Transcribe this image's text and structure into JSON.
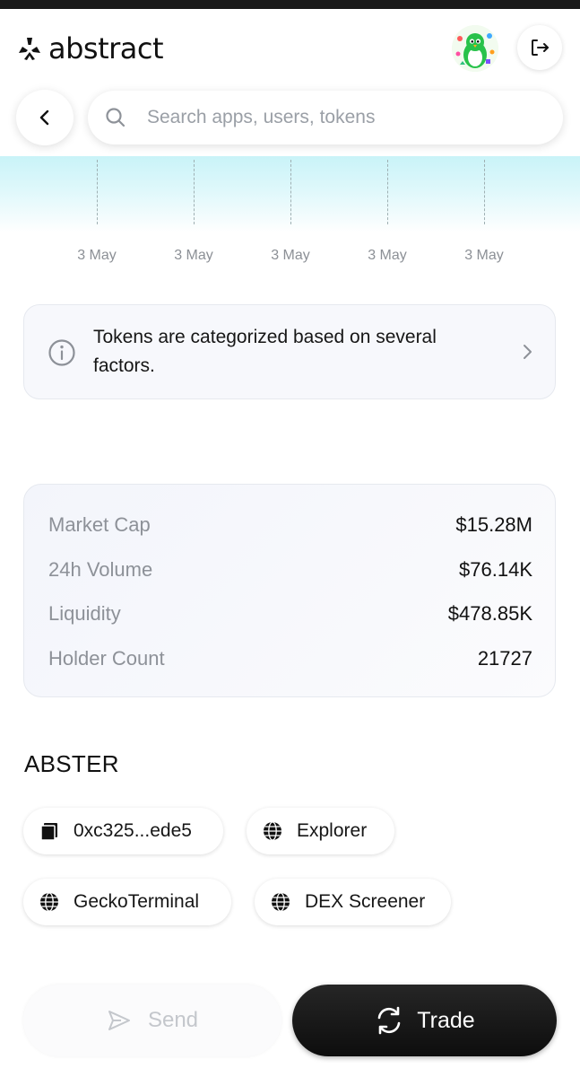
{
  "header": {
    "brand": "abstract",
    "icons": {
      "logo": "abstract-logo-icon",
      "avatar": "penguin-avatar",
      "logout": "logout-icon"
    }
  },
  "nav": {
    "back_icon": "chevron-left-icon",
    "search": {
      "placeholder": "Search apps, users, tokens",
      "value": "",
      "icon": "search-icon"
    }
  },
  "chart_data": {
    "type": "area",
    "x": [
      "3 May",
      "3 May",
      "3 May",
      "3 May",
      "3 May"
    ],
    "series": [],
    "grid": "vertical-dashed"
  },
  "info_banner": {
    "text": "Tokens are categorized based on several factors.",
    "icon": "info-icon",
    "chevron": "chevron-right-icon"
  },
  "stats": [
    {
      "label": "Market Cap",
      "value": "$15.28M"
    },
    {
      "label": "24h Volume",
      "value": "$76.14K"
    },
    {
      "label": "Liquidity",
      "value": "$478.85K"
    },
    {
      "label": "Holder Count",
      "value": "21727"
    }
  ],
  "token": {
    "name": "ABSTER",
    "links": [
      {
        "label": "0xc325...ede5",
        "icon": "copy-icon"
      },
      {
        "label": "Explorer",
        "icon": "globe-icon"
      },
      {
        "label": "GeckoTerminal",
        "icon": "globe-icon"
      },
      {
        "label": "DEX Screener",
        "icon": "globe-icon"
      }
    ]
  },
  "actions": {
    "send_label": "Send",
    "trade_label": "Trade"
  },
  "colors": {
    "chart_fill": "#c9f3f8",
    "trade_button": "#111111",
    "muted_text": "#8d9198"
  }
}
